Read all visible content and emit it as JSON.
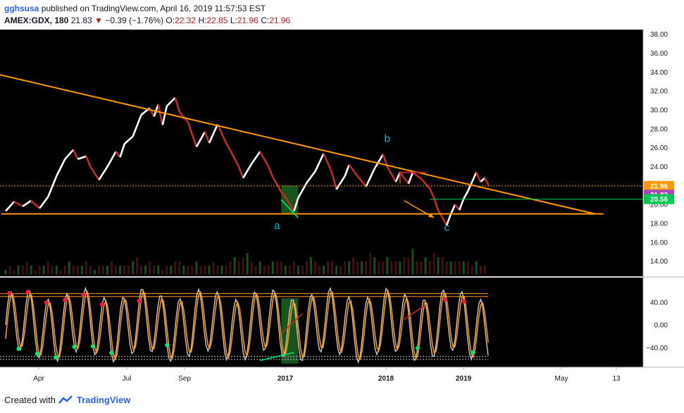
{
  "header": {
    "user": "gghsusa",
    "published": "published on TradingView.com, April 16, 2019 11:57:53 EST",
    "symbol": "AMEX:GDX, 180",
    "last": "21.83",
    "change": "−0.39 (−1.76%)",
    "o_label": "O:",
    "o_value": "22.32",
    "h_label": "H:",
    "h_value": "22.85",
    "l_label": "L:",
    "l_value": "21.96",
    "c_label": "C:",
    "c_value": "21.96"
  },
  "footer": {
    "created_with": "Created with",
    "brand": "TradingView"
  },
  "colors": {
    "trendline": "#ff9800",
    "kagi_up": "#ffffff",
    "kagi_down": "#c62828",
    "stoch_line": "#c8c8c8",
    "stoch_signal": "#ff9800",
    "dot_bull": "#00e676",
    "dot_bear": "#ff1744",
    "wave_label": "#00bcd4",
    "current_tag": "#ff9800",
    "close_tag": "#ab47bc",
    "green_tag": "#00c853",
    "green_box": "#1b5e20"
  },
  "chart_data": [
    {
      "type": "line",
      "description_source": "price panel",
      "x_ticks": [
        "Apr",
        "Jul",
        "Sep",
        "2017",
        "2018",
        "2019",
        "May",
        "13"
      ],
      "y_ticks": [
        14,
        16,
        18,
        20,
        22,
        24,
        26,
        28,
        30,
        32,
        34,
        36,
        38
      ],
      "ylim": [
        13,
        38.2
      ],
      "price_tags": [
        {
          "value": 21.96,
          "label": "21.96",
          "color": "#ff9800"
        },
        {
          "value": 21.03,
          "label": "21.83",
          "color": "#ab47bc"
        },
        {
          "value": 20.56,
          "label": "20.56",
          "color": "#00c853"
        }
      ],
      "price_path": [
        [
          0,
          19.3
        ],
        [
          2,
          20.3
        ],
        [
          4,
          19.8
        ],
        [
          6,
          20.4
        ],
        [
          8,
          19.6
        ],
        [
          10,
          20.8
        ],
        [
          12,
          23.0
        ],
        [
          14,
          24.8
        ],
        [
          16,
          25.8
        ],
        [
          17,
          24.8
        ],
        [
          19,
          25.1
        ],
        [
          20,
          24.0
        ],
        [
          22,
          22.6
        ],
        [
          24,
          24.0
        ],
        [
          26,
          25.6
        ],
        [
          27,
          25.0
        ],
        [
          28,
          26.4
        ],
        [
          30,
          27.2
        ],
        [
          32,
          29.5
        ],
        [
          34,
          30.2
        ],
        [
          35,
          29.3
        ],
        [
          36,
          30.6
        ],
        [
          37,
          28.4
        ],
        [
          38,
          30.4
        ],
        [
          40,
          31.3
        ],
        [
          41,
          29.8
        ],
        [
          43,
          28.7
        ],
        [
          45,
          26.1
        ],
        [
          47,
          27.7
        ],
        [
          48,
          26.5
        ],
        [
          50,
          28.5
        ],
        [
          52,
          26.5
        ],
        [
          53,
          25.7
        ],
        [
          55,
          24.0
        ],
        [
          56,
          22.8
        ],
        [
          58,
          24.3
        ],
        [
          60,
          25.6
        ],
        [
          62,
          24.0
        ],
        [
          63,
          22.9
        ],
        [
          65,
          21.3
        ],
        [
          66,
          20.8
        ],
        [
          67,
          20.0
        ],
        [
          68,
          19.3
        ],
        [
          69,
          20.7
        ],
        [
          71,
          22.3
        ],
        [
          73,
          23.5
        ],
        [
          75,
          25.4
        ],
        [
          77,
          23.3
        ],
        [
          78,
          21.6
        ],
        [
          80,
          23.0
        ],
        [
          81,
          24.2
        ],
        [
          83,
          23.0
        ],
        [
          85,
          21.9
        ],
        [
          87,
          23.8
        ],
        [
          89,
          25.3
        ],
        [
          90,
          24.0
        ],
        [
          92,
          22.4
        ],
        [
          93,
          23.4
        ],
        [
          95,
          22.2
        ],
        [
          96,
          23.4
        ],
        [
          98,
          22.7
        ],
        [
          100,
          21.7
        ],
        [
          101,
          20.7
        ],
        [
          102,
          19.4
        ],
        [
          103,
          18.6
        ],
        [
          104,
          17.8
        ],
        [
          105,
          19.0
        ],
        [
          106,
          20.0
        ],
        [
          107,
          19.4
        ],
        [
          108,
          20.6
        ],
        [
          109,
          21.4
        ],
        [
          110,
          22.4
        ],
        [
          111,
          23.4
        ],
        [
          112,
          22.4
        ],
        [
          113,
          22.8
        ],
        [
          114,
          21.96
        ]
      ],
      "volume": [
        1,
        2,
        1,
        2,
        2,
        3,
        2,
        1,
        2,
        2,
        3,
        2,
        2,
        1,
        2,
        3,
        2,
        2,
        2,
        3,
        2,
        1,
        2,
        2,
        2,
        3,
        2,
        2,
        2,
        2,
        3,
        4,
        2,
        2,
        3,
        2,
        2,
        1,
        2,
        2,
        3,
        3,
        2,
        2,
        2,
        3,
        2,
        2,
        2,
        3,
        2,
        2,
        2,
        3,
        4,
        3,
        4,
        5,
        3,
        2,
        3,
        2,
        2,
        3,
        3,
        3,
        2,
        2,
        3,
        2,
        2,
        3,
        4,
        3,
        2,
        2,
        3,
        3,
        2,
        2,
        3,
        3,
        4,
        3,
        3,
        3,
        5,
        4,
        3,
        3,
        4,
        3,
        3,
        3,
        4,
        4,
        6,
        3,
        3,
        4,
        3,
        5,
        4,
        4,
        3,
        3,
        3,
        3,
        3,
        3,
        2,
        3,
        2,
        2
      ],
      "trendlines": [
        {
          "name": "descending resistance",
          "from": [
            -4,
            34.0
          ],
          "to": [
            139,
            19.0
          ]
        },
        {
          "name": "horizontal support",
          "from": [
            -1,
            19.0
          ],
          "to": [
            141,
            19.0
          ]
        }
      ],
      "wave_labels": [
        {
          "text": "a",
          "x": 64,
          "y": 17.4
        },
        {
          "text": "b",
          "x": 90,
          "y": 26.6
        },
        {
          "text": "c",
          "x": 104,
          "y": 17.2
        }
      ]
    },
    {
      "type": "line",
      "description_source": "stochastic oscillator panel",
      "y_ticks": [
        40.0,
        0.0,
        -40.0
      ],
      "tick_labels": [
        "40.00",
        "0.00",
        "−40.00"
      ],
      "ylim": [
        -70,
        78
      ],
      "bands": [
        55,
        50,
        -55,
        -60
      ]
    }
  ]
}
